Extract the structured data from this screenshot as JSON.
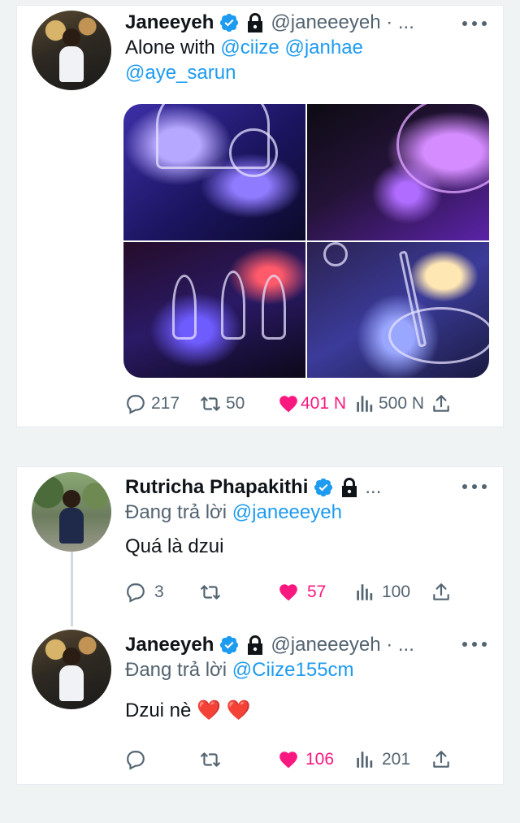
{
  "tweets": [
    {
      "author": "Janeeyeh",
      "handle": "@janeeeyeh · ...",
      "text_prefix": "Alone with ",
      "mentions": [
        "@ciize",
        "@janhae",
        "@aye_sarun"
      ],
      "media": {
        "photo_count": 4
      },
      "replies": "217",
      "retweets": "50",
      "likes": "401 N",
      "views": "500 N"
    }
  ],
  "thread": [
    {
      "author": "Rutricha Phapakithi",
      "handle": "...",
      "replying_label": "Đang trả lời ",
      "replying_to": "@janeeeyeh",
      "text": "Quá là dzui",
      "replies": "3",
      "retweets": "",
      "likes": "57",
      "views": "100"
    },
    {
      "author": "Janeeyeh",
      "handle": "@janeeeyeh · ...",
      "replying_label": "Đang trả lời ",
      "replying_to": "@Ciize155cm",
      "text": "Dzui nè ❤️ ❤️",
      "replies": "",
      "retweets": "",
      "likes": "106",
      "views": "201"
    }
  ],
  "colors": {
    "accent": "#1d9bf0",
    "like": "#f91880",
    "muted": "#536471",
    "background": "#eff3f4"
  },
  "icons": [
    "verified-badge-icon",
    "lock-icon",
    "more-icon",
    "reply-icon",
    "retweet-icon",
    "like-icon",
    "views-icon",
    "share-icon"
  ]
}
